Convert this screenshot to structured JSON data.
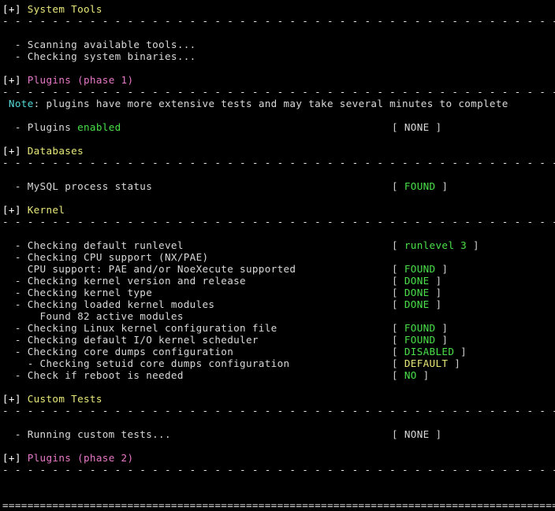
{
  "terminal": {
    "title": "lynis system audit output",
    "background_color": "#000000",
    "colors": {
      "white": "#d9d9d9",
      "bright_white": "#ffffff",
      "green": "#4ae04a",
      "yellow": "#e8e87a",
      "magenta": "#e878c8",
      "cyan": "#54d7d7"
    },
    "bracket_open": "[",
    "bracket_close": "]",
    "header_marker": "[+]",
    "bullet": "-",
    "separator_dashes": "- - - - - - - - - - - - - - - - - - - - - - - - - - - - - - - - - - - - - - - - - - - - - - - -",
    "footer_equals": "================================================================================================",
    "sections": [
      {
        "name": "system-tools",
        "header": "System Tools",
        "header_color": "yellow",
        "entries": [
          {
            "indent": 1,
            "bullet": true,
            "label": "Scanning available tools...",
            "status": null
          },
          {
            "indent": 1,
            "bullet": true,
            "label": "Checking system binaries...",
            "status": null
          }
        ]
      },
      {
        "name": "plugins-phase-1",
        "header": "Plugins (phase 1)",
        "header_color": "magenta",
        "note": {
          "prefix": "Note",
          "text": ": plugins have more extensive tests and may take several minutes to complete"
        },
        "entries": [
          {
            "indent": 1,
            "bullet": true,
            "label": "Plugins ",
            "label_accent": "enabled",
            "label_accent_color": "green",
            "status": "NONE",
            "status_color": "white"
          }
        ]
      },
      {
        "name": "databases",
        "header": "Databases",
        "header_color": "yellow",
        "entries": [
          {
            "indent": 1,
            "bullet": true,
            "label": "MySQL process status",
            "status": "FOUND",
            "status_color": "green"
          }
        ]
      },
      {
        "name": "kernel",
        "header": "Kernel",
        "header_color": "yellow",
        "entries": [
          {
            "indent": 1,
            "bullet": true,
            "label": "Checking default runlevel",
            "status": "runlevel 3",
            "status_color": "green"
          },
          {
            "indent": 1,
            "bullet": true,
            "label": "Checking CPU support (NX/PAE)",
            "status": null
          },
          {
            "indent": 2,
            "bullet": false,
            "label": "CPU support: PAE and/or NoeXecute supported",
            "status": "FOUND",
            "status_color": "green"
          },
          {
            "indent": 1,
            "bullet": true,
            "label": "Checking kernel version and release",
            "status": "DONE",
            "status_color": "green"
          },
          {
            "indent": 1,
            "bullet": true,
            "label": "Checking kernel type",
            "status": "DONE",
            "status_color": "green"
          },
          {
            "indent": 1,
            "bullet": true,
            "label": "Checking loaded kernel modules",
            "status": "DONE",
            "status_color": "green"
          },
          {
            "indent": 3,
            "bullet": false,
            "label": "Found 82 active modules",
            "status": null
          },
          {
            "indent": 1,
            "bullet": true,
            "label": "Checking Linux kernel configuration file",
            "status": "FOUND",
            "status_color": "green"
          },
          {
            "indent": 1,
            "bullet": true,
            "label": "Checking default I/O kernel scheduler",
            "status": "FOUND",
            "status_color": "green"
          },
          {
            "indent": 1,
            "bullet": true,
            "label": "Checking core dumps configuration",
            "status": "DISABLED",
            "status_color": "green"
          },
          {
            "indent": 2,
            "bullet": true,
            "label": "Checking setuid core dumps configuration",
            "status": "DEFAULT",
            "status_color": "yellow"
          },
          {
            "indent": 1,
            "bullet": true,
            "label": "Check if reboot is needed",
            "status": "NO",
            "status_color": "green"
          }
        ]
      },
      {
        "name": "custom-tests",
        "header": "Custom Tests",
        "header_color": "yellow",
        "entries": [
          {
            "indent": 1,
            "bullet": true,
            "label": "Running custom tests...",
            "status": "NONE",
            "status_color": "white"
          }
        ]
      },
      {
        "name": "plugins-phase-2",
        "header": "Plugins (phase 2)",
        "header_color": "magenta",
        "entries": []
      }
    ]
  }
}
